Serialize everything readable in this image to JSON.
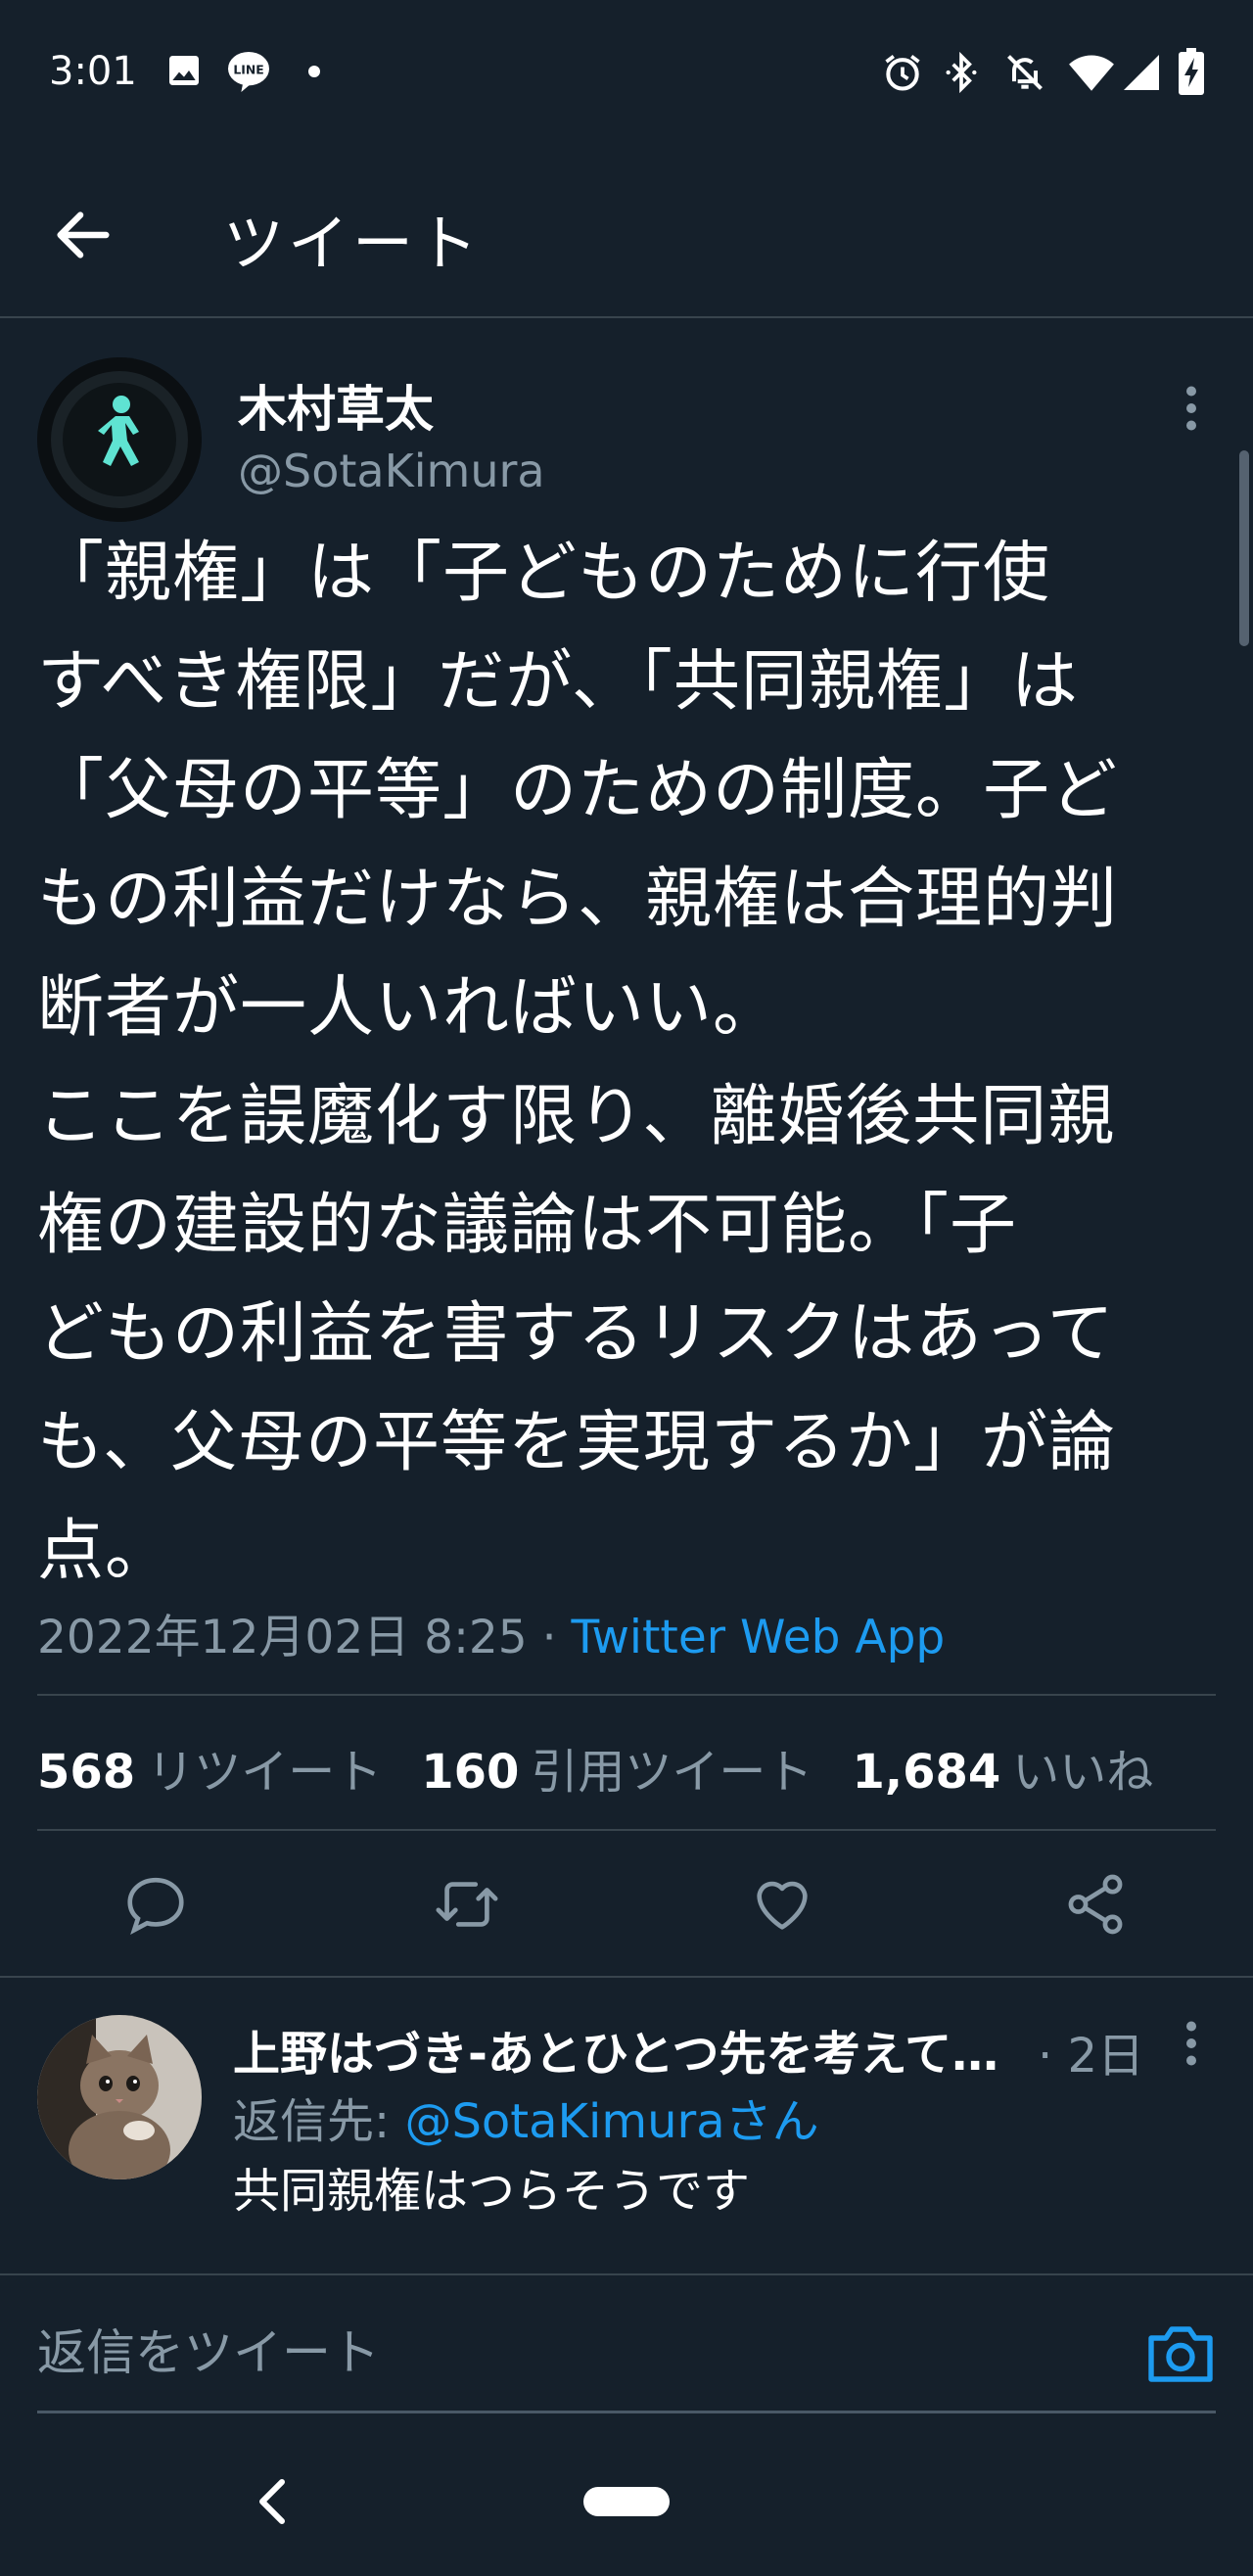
{
  "status_bar": {
    "time": "3:01",
    "left_icons": [
      "image-icon",
      "line-app-icon",
      "dot-icon"
    ],
    "right_icons": [
      "alarm-icon",
      "bluetooth-icon",
      "notifications-off-icon",
      "wifi-icon",
      "signal-icon",
      "battery-charging-icon"
    ]
  },
  "header": {
    "title": "ツイート",
    "back_icon": "arrow-left-icon"
  },
  "tweet": {
    "author_name": "木村草太",
    "author_handle": "@SotaKimura",
    "text": "「親権」は「子どものために行使\nすべき権限」だが、「共同親権」は\n「父母の平等」のための制度。子ど\nもの利益だけなら、親権は合理的判\n断者が一人いればいい。\nここを誤魔化す限り、離婚後共同親\n権の建設的な議論は不可能。「子\nどもの利益を害するリスクはあって\nも、父母の平等を実現するか」が論\n点。",
    "datetime": "2022年12月02日 8:25",
    "separator": " · ",
    "via": "Twitter Web App",
    "stats": {
      "retweets": "568",
      "retweets_label": "リツイート",
      "quotes": "160",
      "quotes_label": "引用ツイート",
      "likes": "1,684",
      "likes_label": "いいね"
    },
    "actions": [
      "reply-icon",
      "retweet-icon",
      "like-icon",
      "share-icon"
    ]
  },
  "reply": {
    "author_name": "上野はづき-あとひとつ先を考えて…",
    "time": "· 2日",
    "reply_to_label": "返信先: ",
    "reply_to_mention": "@SotaKimuraさん",
    "text": "共同親権はつらそうです"
  },
  "compose": {
    "placeholder": "返信をツイート",
    "camera_icon": "camera-icon"
  },
  "colors": {
    "background": "#15202b",
    "accent": "#1d9bf0",
    "secondary_text": "#8899a6",
    "divider": "#38444d"
  }
}
